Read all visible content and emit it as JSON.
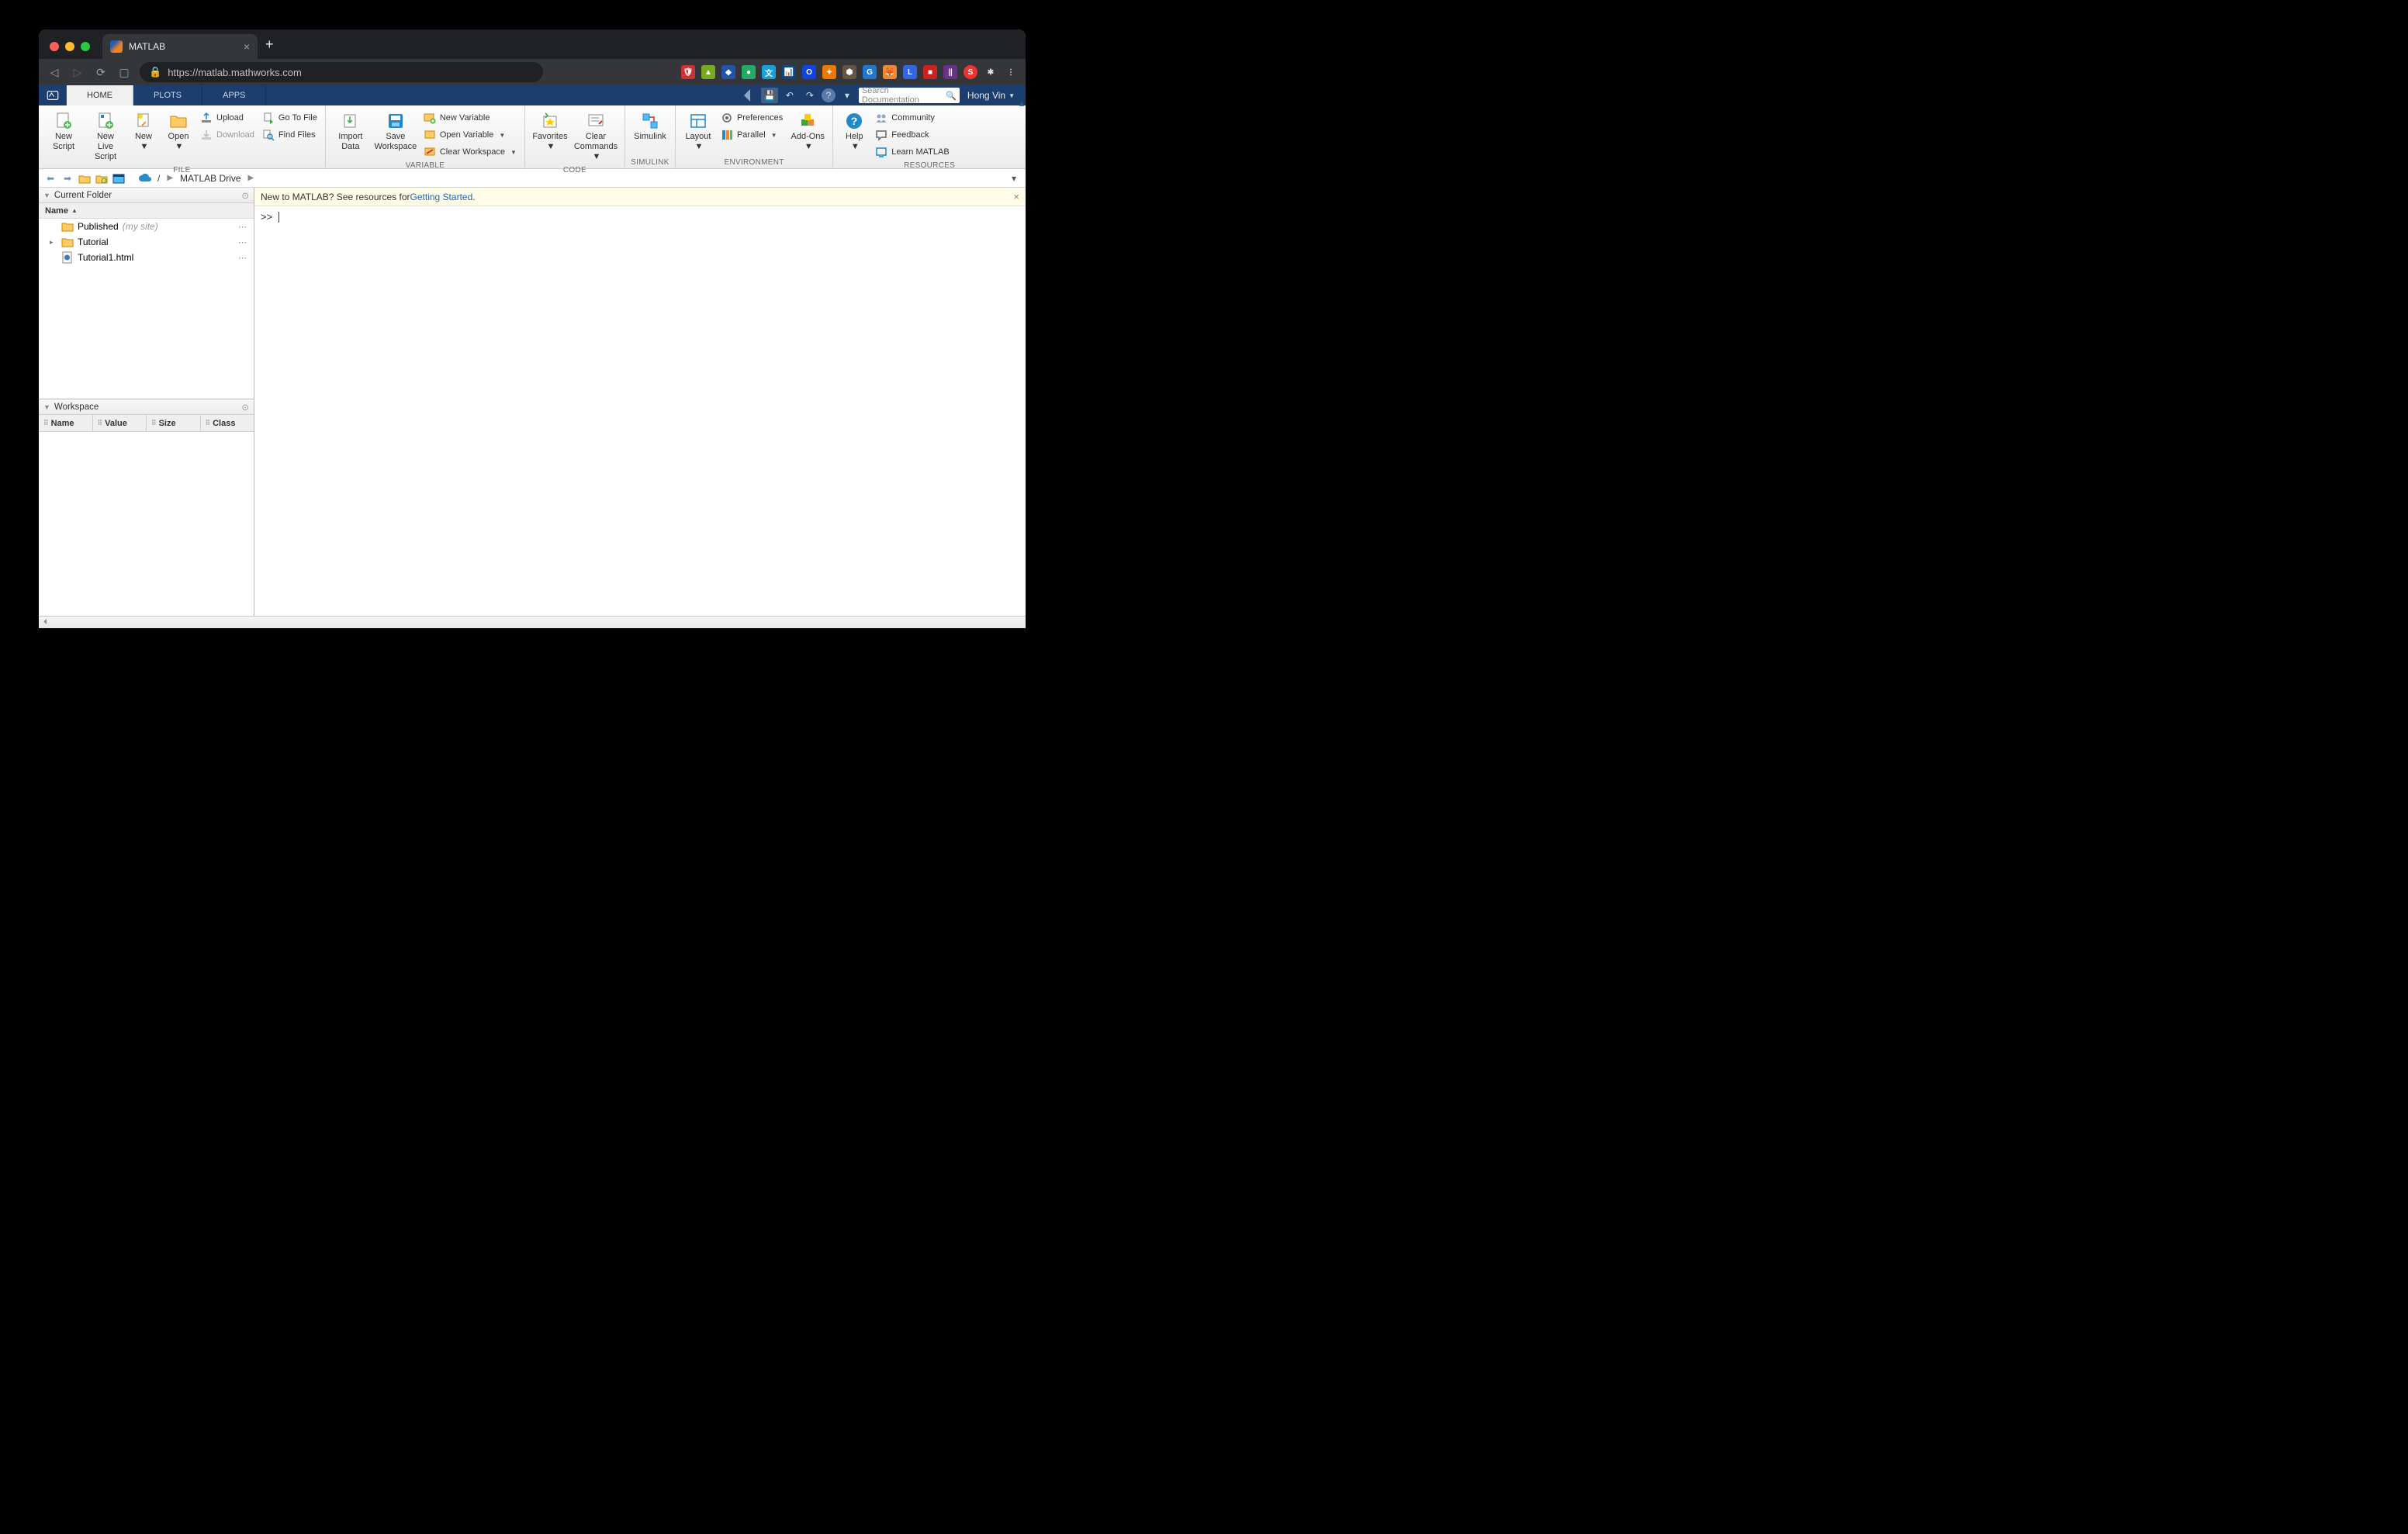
{
  "browser": {
    "tab_title": "MATLAB",
    "url": "https://matlab.mathworks.com"
  },
  "tabstrip": {
    "tabs": [
      "HOME",
      "PLOTS",
      "APPS"
    ],
    "active": 0,
    "search_placeholder": "Search Documentation",
    "user": "Hong Vin"
  },
  "ribbon": {
    "file": {
      "label": "FILE",
      "new_script": "New\nScript",
      "new_live_script": "New\nLive Script",
      "new": "New",
      "open": "Open",
      "upload": "Upload",
      "download": "Download",
      "go_to_file": "Go To File",
      "find_files": "Find Files"
    },
    "variable": {
      "label": "VARIABLE",
      "import_data": "Import\nData",
      "save_workspace": "Save\nWorkspace",
      "new_variable": "New Variable",
      "open_variable": "Open Variable",
      "clear_workspace": "Clear Workspace"
    },
    "code": {
      "label": "CODE",
      "favorites": "Favorites",
      "clear_commands": "Clear\nCommands"
    },
    "simulink": {
      "label": "SIMULINK",
      "simulink": "Simulink"
    },
    "environment": {
      "label": "ENVIRONMENT",
      "layout": "Layout",
      "preferences": "Preferences",
      "parallel": "Parallel",
      "addons": "Add-Ons"
    },
    "resources": {
      "label": "RESOURCES",
      "help": "Help",
      "community": "Community",
      "feedback": "Feedback",
      "learn": "Learn MATLAB"
    }
  },
  "path": {
    "root": "/",
    "crumbs": [
      "MATLAB Drive"
    ]
  },
  "current_folder": {
    "title": "Current Folder",
    "col_name": "Name",
    "items": [
      {
        "name": "Published",
        "muted": "(my site)",
        "type": "folder",
        "shared": false
      },
      {
        "name": "Tutorial",
        "type": "folder",
        "expandable": true
      },
      {
        "name": "Tutorial1.html",
        "type": "html"
      }
    ]
  },
  "workspace": {
    "title": "Workspace",
    "cols": [
      "Name",
      "Value",
      "Size",
      "Class"
    ]
  },
  "banner": {
    "prefix": "New to MATLAB? See resources for ",
    "link": "Getting Started",
    "suffix": "."
  },
  "command": {
    "prompt": ">> "
  }
}
